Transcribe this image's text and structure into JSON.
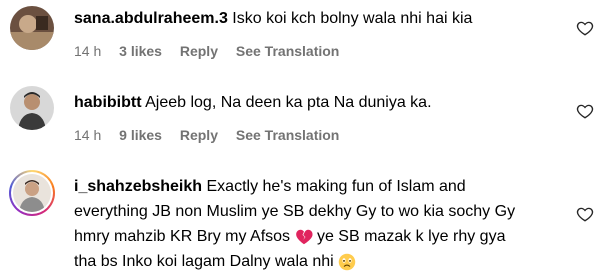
{
  "comments": [
    {
      "username": "sana.abdulraheem.3",
      "text": "Isko koi kch bolny wala nhi hai kia",
      "time": "14 h",
      "likes": "3 likes",
      "reply": "Reply",
      "translate": "See Translation",
      "icons": {
        "like": "heart-outline-icon"
      }
    },
    {
      "username": "habibibtt",
      "text": "Ajeeb log, Na deen ka pta Na duniya ka.",
      "time": "14 h",
      "likes": "9 likes",
      "reply": "Reply",
      "translate": "See Translation",
      "icons": {
        "like": "heart-outline-icon"
      }
    },
    {
      "username": "i_shahzebsheikh",
      "line1": "Exactly he's making fun of Islam and",
      "line2": "everything JB non Muslim ye SB dekhy Gy to wo kia sochy Gy",
      "line3a": "hmry mahzib KR Bry my Afsos",
      "line3b": "ye SB mazak k lye rhy gya",
      "line4": "tha bs Inko koi lagam Dalny wala nhi",
      "icons": {
        "like": "heart-outline-icon",
        "emoji1": "broken-heart-icon",
        "emoji2": "sad-face-icon"
      }
    }
  ],
  "colors": {
    "meta": "#737373",
    "text": "#000000",
    "story_ring": "gradient"
  }
}
